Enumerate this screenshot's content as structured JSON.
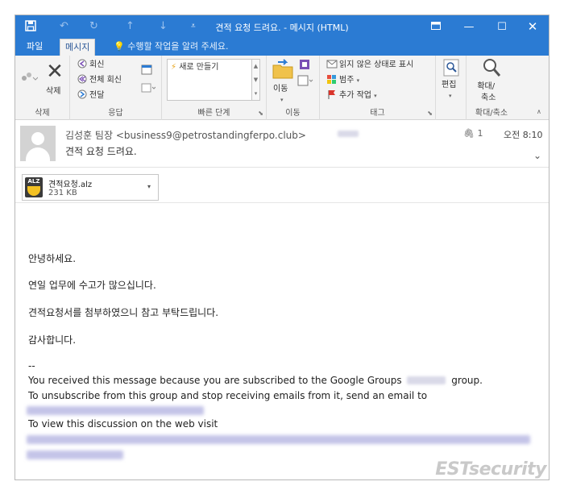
{
  "window": {
    "title": "견적 요청 드려요. - 메시지 (HTML)",
    "colors": {
      "titlebar": "#2b7bd3",
      "ribbon": "#f3f3f3"
    }
  },
  "tabs": {
    "file": "파일",
    "message": "메시지",
    "tell_me": "수행할 작업을 알려 주세요."
  },
  "ribbon": {
    "delete_group": {
      "label": "삭제",
      "delete_button": "삭제"
    },
    "respond_group": {
      "label": "응답",
      "reply": "회신",
      "reply_all": "전체 회신",
      "forward": "전달"
    },
    "quick_steps_group": {
      "label": "빠른 단계",
      "new": "새로 만들기"
    },
    "move_group": {
      "label": "이동",
      "move_button": "이동"
    },
    "tags_group": {
      "label": "태그",
      "mark_unread": "읽지 않은 상태로 표시",
      "categorize": "범주",
      "follow_up": "추가 작업"
    },
    "editing_group": {
      "edit_button": "편집"
    },
    "zoom_group": {
      "label": "확대/축소",
      "zoom_button_line1": "확대/",
      "zoom_button_line2": "축소"
    }
  },
  "header": {
    "sender": "김성훈 팀장 <business9@petrostandingferpo.club>",
    "subject": "견적 요청 드려요.",
    "attachment_count": "1",
    "time": "오전 8:10"
  },
  "attachment": {
    "icon_label": "ALZ",
    "name": "견적요청.alz",
    "size": "231 KB"
  },
  "body": {
    "greeting": "안녕하세요.",
    "line1": "연일 업무에 수고가 많으십니다.",
    "line2": "견적요청서를 첨부하였으니 참고 부탁드립니다.",
    "closing": "감사합니다.",
    "separator": "--",
    "footer1_pre": "You received this message because you are subscribed to the Google Groups",
    "footer1_post": "group.",
    "footer2": "To unsubscribe from this group and stop receiving emails from it, send an email to",
    "footer3": "To view this discussion on the web visit"
  },
  "watermark": "ESTsecurity"
}
